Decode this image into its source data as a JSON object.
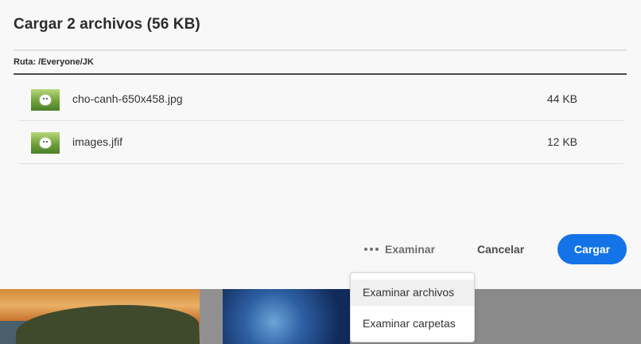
{
  "dialog": {
    "title": "Cargar 2 archivos (56 KB)",
    "path_label": "Ruta: /Everyone/JK",
    "files": [
      {
        "name": "cho-canh-650x458.jpg",
        "size": "44 KB",
        "thumb_icon": "puppy-thumbnail"
      },
      {
        "name": "images.jfif",
        "size": "12 KB",
        "thumb_icon": "puppy-thumbnail"
      }
    ],
    "actions": {
      "browse_label": "Examinar",
      "cancel_label": "Cancelar",
      "upload_label": "Cargar"
    }
  },
  "browse_menu": {
    "items": [
      {
        "label": "Examinar archivos"
      },
      {
        "label": "Examinar carpetas"
      }
    ]
  },
  "colors": {
    "accent": "#1473e6",
    "text": "#2c2c2c",
    "background": "#f8f8f8"
  }
}
